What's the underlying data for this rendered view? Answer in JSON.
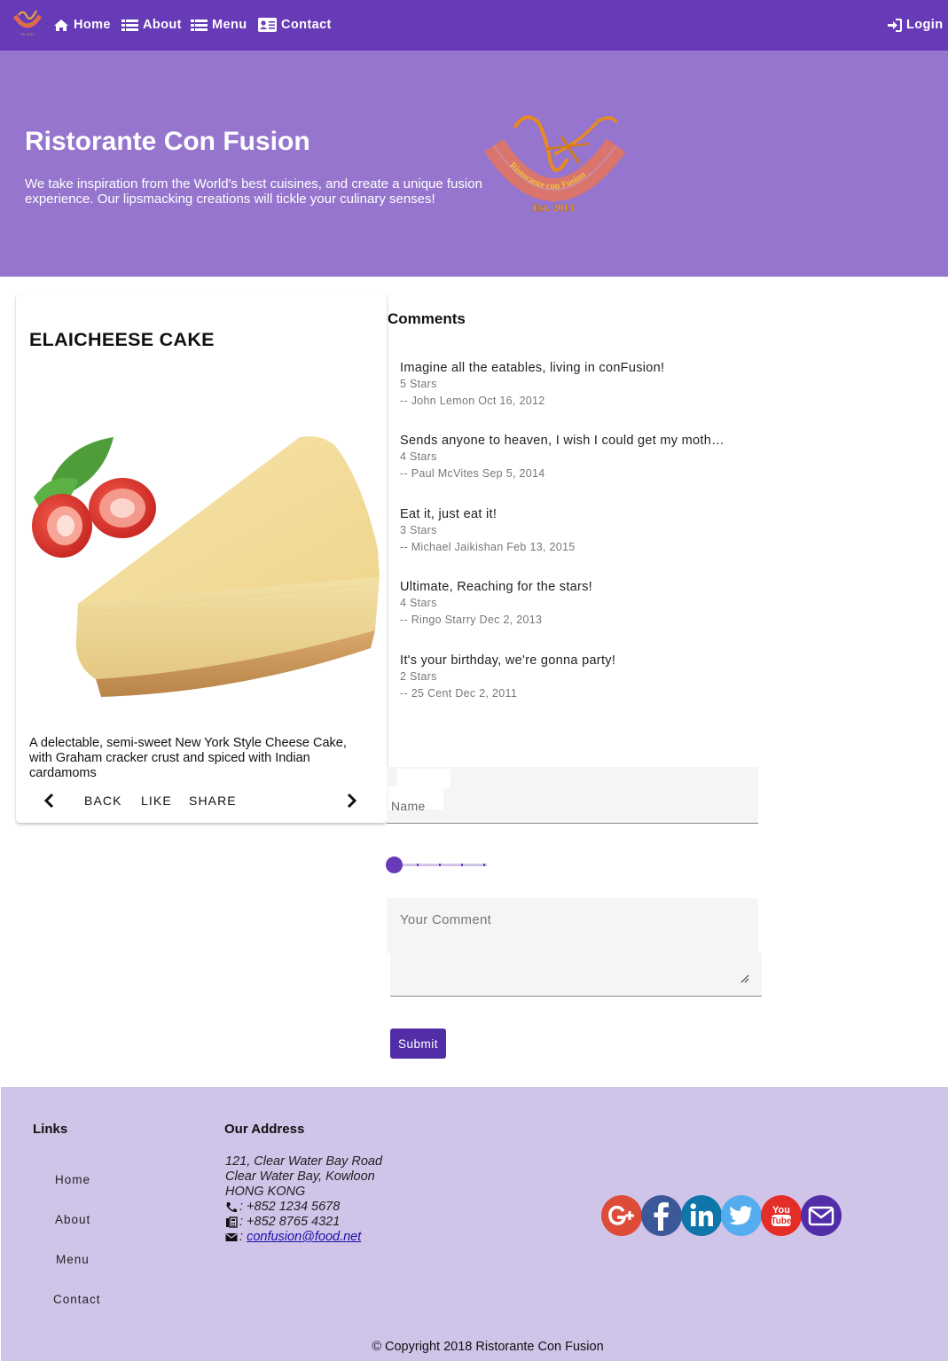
{
  "nav": {
    "home": "Home",
    "about": "About",
    "menu": "Menu",
    "contact": "Contact",
    "login": "Login"
  },
  "jumbotron": {
    "title": "Ristorante Con Fusion",
    "text": "We take inspiration from the World's best cuisines, and create a unique fusion experience. Our lipsmacking creations will tickle your culinary senses!",
    "logo_text": "Ristorante con Fusion",
    "logo_est": "Est. 2013"
  },
  "dish": {
    "name": "ELAICHEESE CAKE",
    "description": "A delectable, semi-sweet New York Style Cheese Cake, with Graham cracker crust and spiced with Indian cardamoms",
    "back": "BACK",
    "like": "LIKE",
    "share": "SHARE"
  },
  "comments": {
    "heading": "Comments",
    "items": [
      {
        "comment": "Imagine all the eatables, living in conFusion!",
        "rating": "5 Stars",
        "author": "-- John Lemon Oct 16, 2012"
      },
      {
        "comment": "Sends anyone to heaven, I wish I could get my moth…",
        "rating": "4 Stars",
        "author": "-- Paul McVites Sep 5, 2014"
      },
      {
        "comment": "Eat it, just eat it!",
        "rating": "3 Stars",
        "author": "-- Michael Jaikishan Feb 13, 2015"
      },
      {
        "comment": "Ultimate, Reaching for the stars!",
        "rating": "4 Stars",
        "author": "-- Ringo Starry Dec 2, 2013"
      },
      {
        "comment": "It's your birthday, we're gonna party!",
        "rating": "2 Stars",
        "author": "-- 25 Cent Dec 2, 2011"
      }
    ]
  },
  "form": {
    "name_placeholder": "Name",
    "rating_value": 1,
    "rating_min": 1,
    "rating_max": 5,
    "comment_placeholder": "Your Comment",
    "submit": "Submit"
  },
  "footer": {
    "links_heading": "Links",
    "links": [
      "Home",
      "About",
      "Menu",
      "Contact"
    ],
    "address_heading": "Our Address",
    "address_lines": [
      "121, Clear Water Bay Road",
      "Clear Water Bay, Kowloon",
      "HONG KONG"
    ],
    "phone": ": +852 1234 5678",
    "fax": ": +852 8765 4321",
    "email_prefix": ": ",
    "email": "confusion@food.net",
    "social": [
      "google-plus",
      "facebook",
      "linkedin",
      "twitter",
      "youtube",
      "mail"
    ],
    "copyright": "© Copyright 2018 Ristorante Con Fusion"
  },
  "colors": {
    "primary": "#673ab7",
    "primary_light": "#9575cd",
    "primary_lighter": "#d1c4e9",
    "primary_dark": "#512da8",
    "google": "#dd4b39",
    "facebook": "#3b5998",
    "linkedin": "#0e76a8",
    "twitter": "#55acee",
    "youtube": "#e52d27"
  }
}
